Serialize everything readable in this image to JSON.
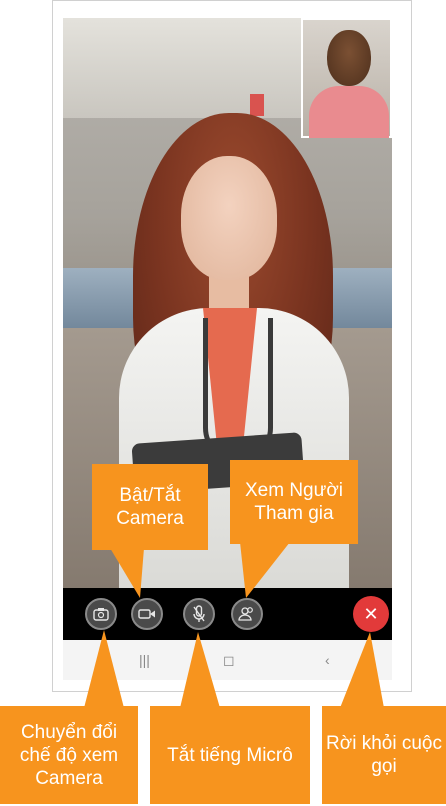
{
  "video": {
    "self_view": "self-view-thumbnail",
    "main_view": "remote-participant-video"
  },
  "controls": {
    "switch_camera_icon": "camera-switch-icon",
    "video_icon": "video-camera-icon",
    "mute_icon": "microphone-icon",
    "participants_icon": "participants-icon",
    "leave_icon": "✕"
  },
  "nav": {
    "recents": "|||",
    "home": "◻",
    "back": "‹"
  },
  "callouts": {
    "toggle_camera": "Bật/Tắt Camera",
    "view_participants": "Xem Người Tham gia",
    "switch_camera_view": "Chuyển đổi chế độ xem Camera",
    "mute_mic": "Tắt tiếng Micrô",
    "leave_call": "Rời khỏi cuộc gọi"
  },
  "colors": {
    "callout": "#f7941e",
    "leave": "#e23a3a",
    "bar": "#000000"
  }
}
